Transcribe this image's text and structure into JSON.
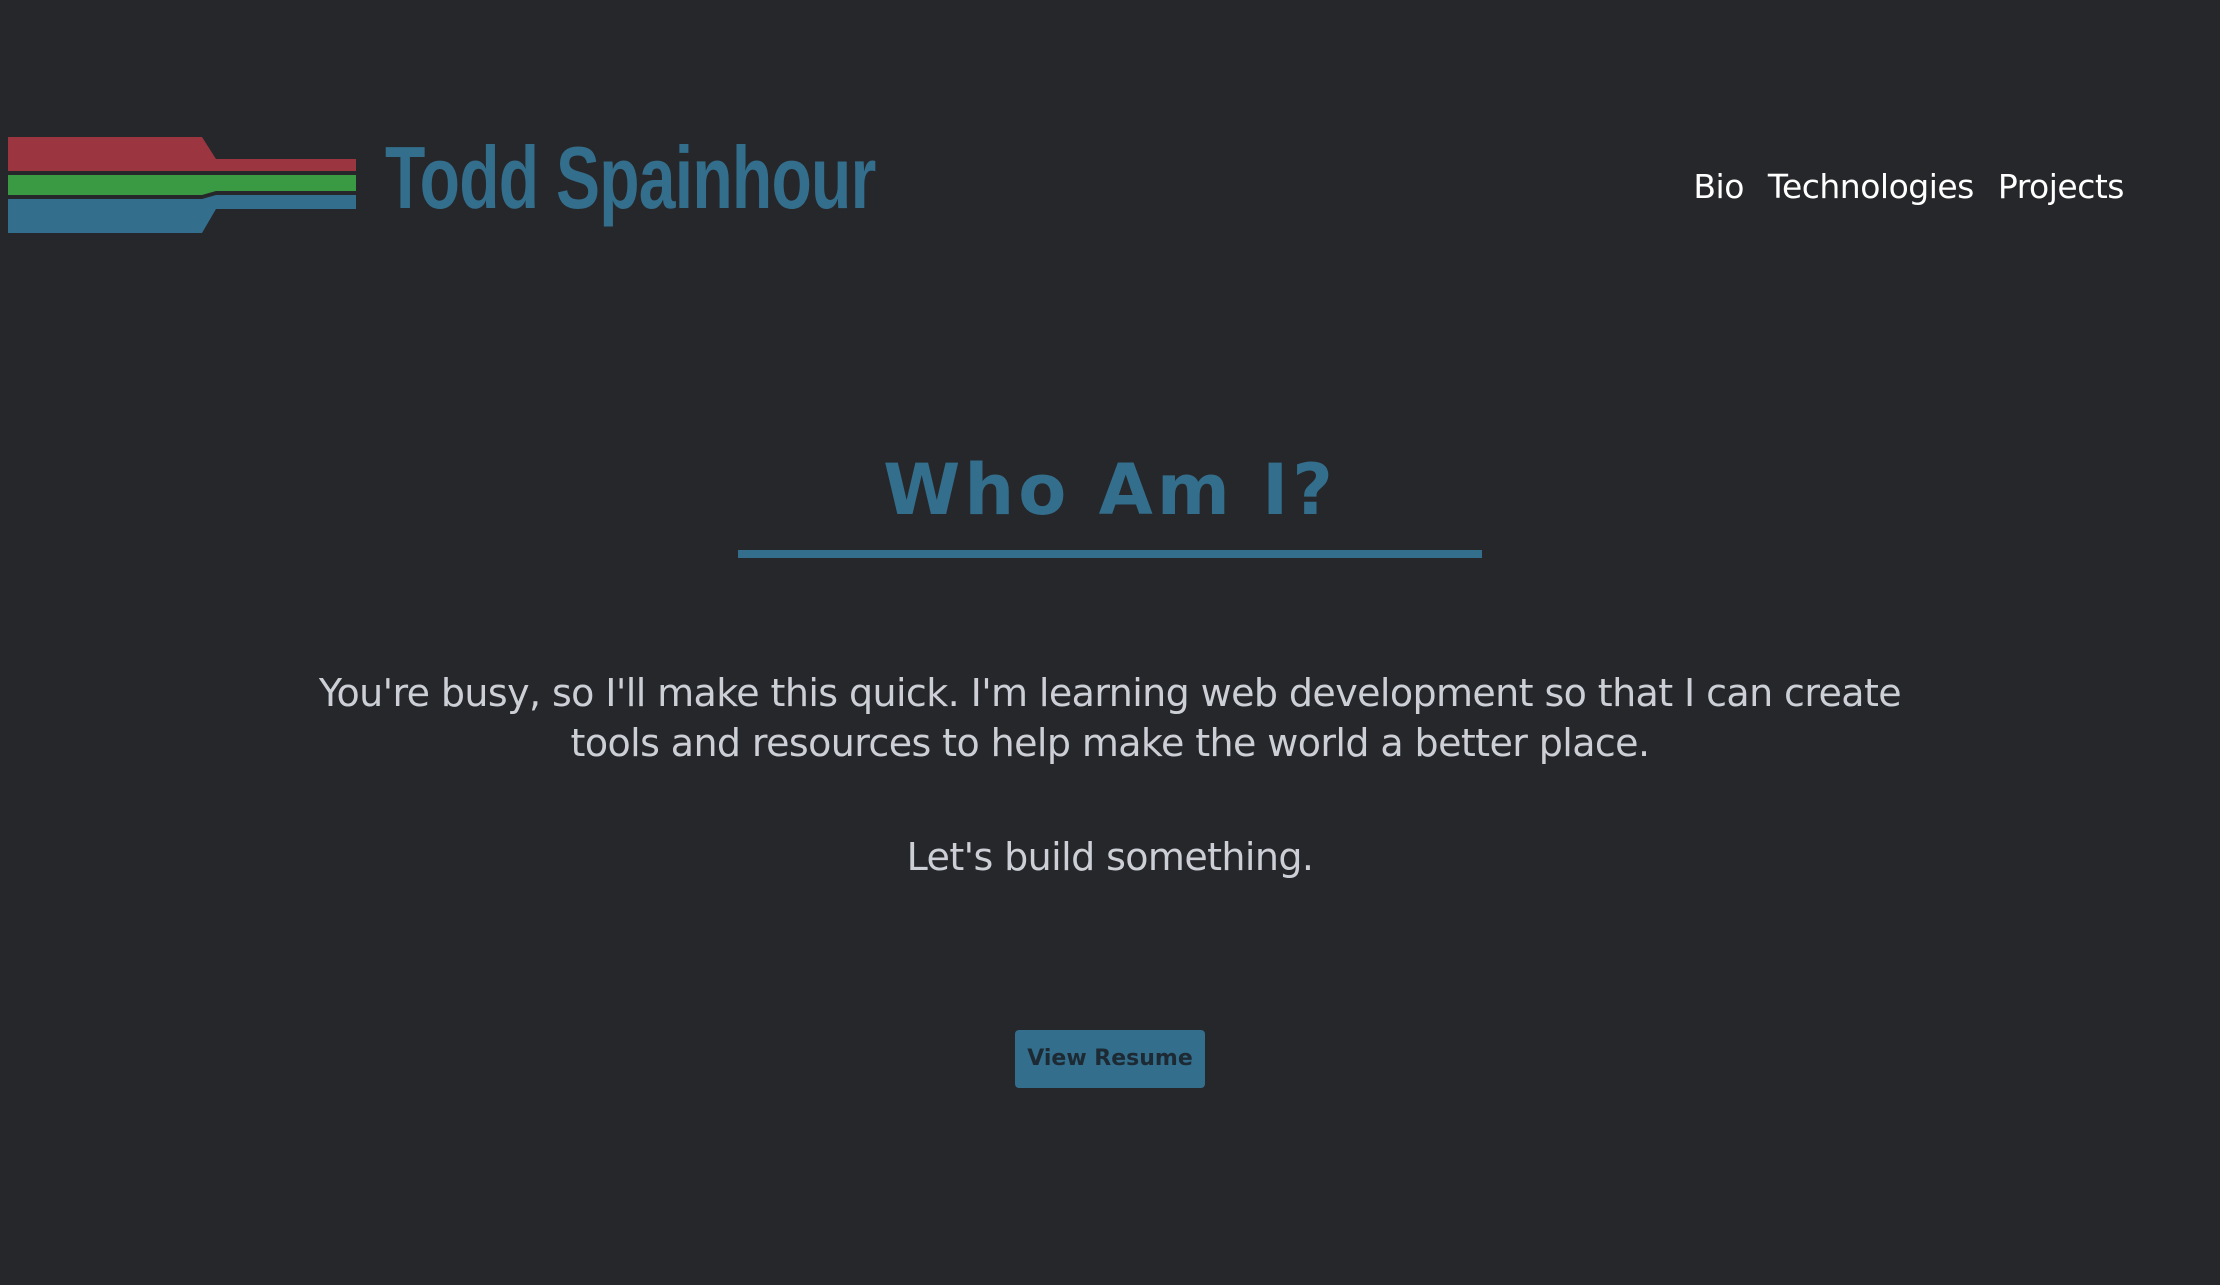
{
  "header": {
    "brand_name": "Todd Spainhour",
    "logo_icon": "tri-color-stripes-logo-icon",
    "nav": [
      {
        "label": "Bio"
      },
      {
        "label": "Technologies"
      },
      {
        "label": "Projects"
      }
    ]
  },
  "main": {
    "title": "Who Am I?",
    "intro": "You're busy, so I'll make this quick. I'm learning web development so that I can create tools and resources to help make the world a better place.",
    "cta_line": "Let's build something.",
    "resume_button_label": "View Resume"
  },
  "colors": {
    "background": "#26272b",
    "accent_blue": "#336e8c",
    "logo_red": "#9b3540",
    "logo_green": "#3a9a43",
    "text_light": "#ccd0d6",
    "nav_text": "#ffffff"
  }
}
